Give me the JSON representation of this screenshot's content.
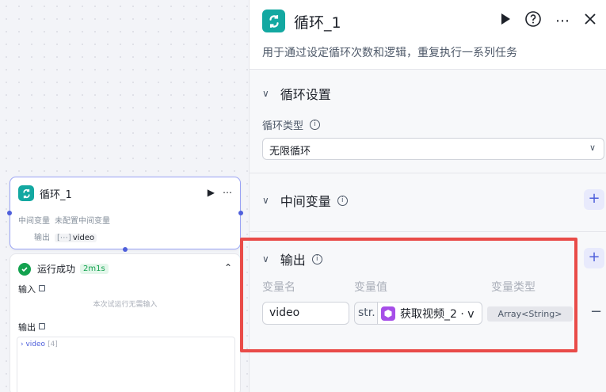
{
  "node": {
    "title": "循环_1",
    "intermediate_label": "中间变量",
    "intermediate_value": "未配置中间变量",
    "output_label": "输出",
    "output_tag_prefix": "[⋯]",
    "output_tag": "video"
  },
  "result": {
    "status": "运行成功",
    "duration": "2m1s",
    "input_label": "输入",
    "input_note": "本次试运行无需输入",
    "output_label": "输出",
    "output_item": "video",
    "output_count": "[4]"
  },
  "panel": {
    "title": "循环_1",
    "description": "用于通过设定循环次数和逻辑，重复执行一系列任务",
    "loop_settings": {
      "heading": "循环设置",
      "type_label": "循环类型",
      "type_value": "无限循环"
    },
    "intermediate": {
      "heading": "中间变量"
    },
    "output": {
      "heading": "输出",
      "col_name": "变量名",
      "col_value": "变量值",
      "col_type": "变量类型",
      "row": {
        "name": "video",
        "value_type": "str.",
        "value_ref": "获取视频_2 · v",
        "var_type": "Array<String>"
      }
    }
  },
  "colors": {
    "accent": "#4e5fdb",
    "loop_icon": "#13a8a1",
    "ref_icon": "#a64ee8",
    "success": "#13a24f",
    "highlight": "#e94b48"
  }
}
